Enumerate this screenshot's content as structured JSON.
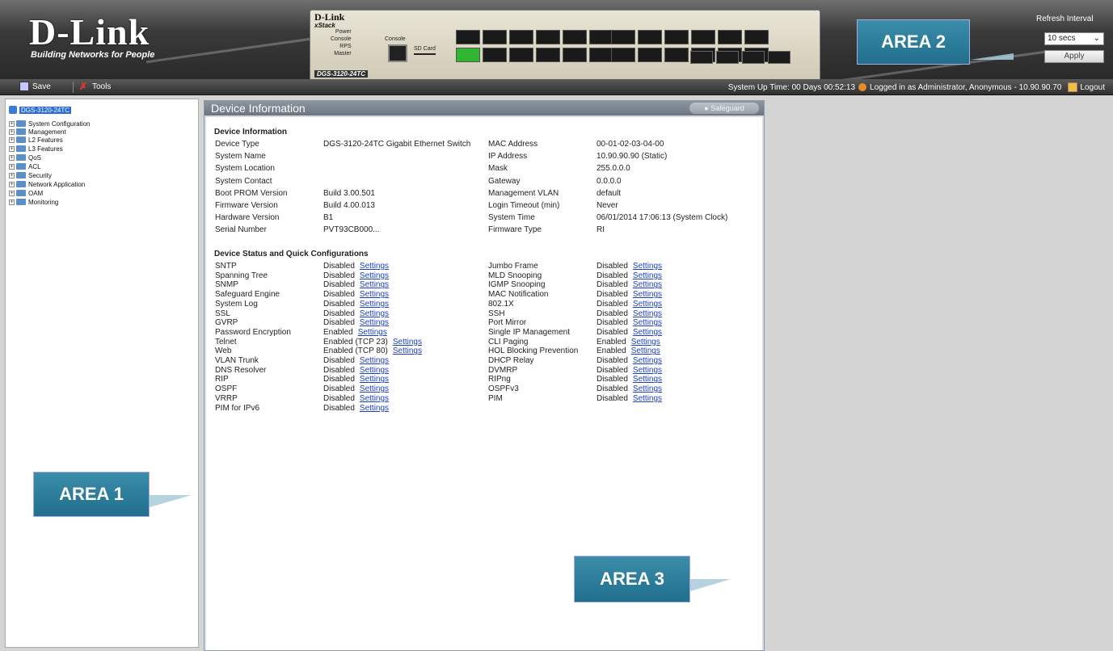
{
  "header": {
    "logo_text": "D-Link",
    "logo_tagline": "Building Networks for People",
    "panel_brand": "D-Link",
    "panel_stack": "xStack",
    "panel_model": "DGS-3120-24TC",
    "panel_labels": [
      "Power",
      "Console",
      "RPS",
      "Master"
    ],
    "console_label": "Console",
    "sd_label": "SD Card",
    "refresh_label": "Refresh Interval",
    "refresh_value": "10 secs",
    "apply_label": "Apply",
    "area2_label": "AREA 2"
  },
  "toolbar": {
    "save_label": "Save",
    "tools_label": "Tools",
    "system_up_time": "System Up Time: 00 Days 00:52:13",
    "logged_in": "Logged in as Administrator, Anonymous - 10.90.90.70",
    "logout_label": "Logout"
  },
  "sidebar": {
    "root": "DGS-3120-24TC",
    "items": [
      "System Configuration",
      "Management",
      "L2 Features",
      "L3 Features",
      "QoS",
      "ACL",
      "Security",
      "Network Application",
      "OAM",
      "Monitoring"
    ],
    "area1_label": "AREA 1"
  },
  "main": {
    "title": "Device Information",
    "safeguard": "Safeguard",
    "info_section": "Device Information",
    "info_left": [
      [
        "Device Type",
        "DGS-3120-24TC Gigabit Ethernet Switch"
      ],
      [
        "System Name",
        ""
      ],
      [
        "System Location",
        ""
      ],
      [
        "System Contact",
        ""
      ],
      [
        "Boot PROM Version",
        "Build 3.00.501"
      ],
      [
        "Firmware Version",
        "Build 4.00.013"
      ],
      [
        "Hardware Version",
        "B1"
      ],
      [
        "Serial Number",
        "PVT93CB000..."
      ]
    ],
    "info_right": [
      [
        "MAC Address",
        "00-01-02-03-04-00"
      ],
      [
        "IP Address",
        "10.90.90.90 (Static)"
      ],
      [
        "Mask",
        "255.0.0.0"
      ],
      [
        "Gateway",
        "0.0.0.0"
      ],
      [
        "Management VLAN",
        "default"
      ],
      [
        "Login Timeout (min)",
        "Never"
      ],
      [
        "System Time",
        "06/01/2014 17:06:13 (System Clock)"
      ],
      [
        "Firmware Type",
        "RI"
      ]
    ],
    "status_section": "Device Status and Quick Configurations",
    "settings_label": "Settings",
    "status_left": [
      [
        "SNTP",
        "Disabled"
      ],
      [
        "Spanning Tree",
        "Disabled"
      ],
      [
        "SNMP",
        "Disabled"
      ],
      [
        "Safeguard Engine",
        "Disabled"
      ],
      [
        "System Log",
        "Disabled"
      ],
      [
        "SSL",
        "Disabled"
      ],
      [
        "GVRP",
        "Disabled"
      ],
      [
        "Password Encryption",
        "Enabled"
      ],
      [
        "Telnet",
        "Enabled  (TCP 23)"
      ],
      [
        "Web",
        "Enabled  (TCP 80)"
      ],
      [
        "VLAN Trunk",
        "Disabled"
      ],
      [
        "DNS Resolver",
        "Disabled"
      ],
      [
        "RIP",
        "Disabled"
      ],
      [
        "OSPF",
        "Disabled"
      ],
      [
        "VRRP",
        "Disabled"
      ],
      [
        "PIM for IPv6",
        "Disabled"
      ]
    ],
    "status_right": [
      [
        "Jumbo Frame",
        "Disabled"
      ],
      [
        "MLD Snooping",
        "Disabled"
      ],
      [
        "IGMP Snooping",
        "Disabled"
      ],
      [
        "MAC Notification",
        "Disabled"
      ],
      [
        "802.1X",
        "Disabled"
      ],
      [
        "SSH",
        "Disabled"
      ],
      [
        "Port Mirror",
        "Disabled"
      ],
      [
        "Single IP Management",
        "Disabled"
      ],
      [
        "CLI Paging",
        "Enabled"
      ],
      [
        "HOL Blocking Prevention",
        "Enabled"
      ],
      [
        "DHCP Relay",
        "Disabled"
      ],
      [
        "DVMRP",
        "Disabled"
      ],
      [
        "RIPng",
        "Disabled"
      ],
      [
        "OSPFv3",
        "Disabled"
      ],
      [
        "PIM",
        "Disabled"
      ]
    ],
    "area3_label": "AREA 3"
  }
}
